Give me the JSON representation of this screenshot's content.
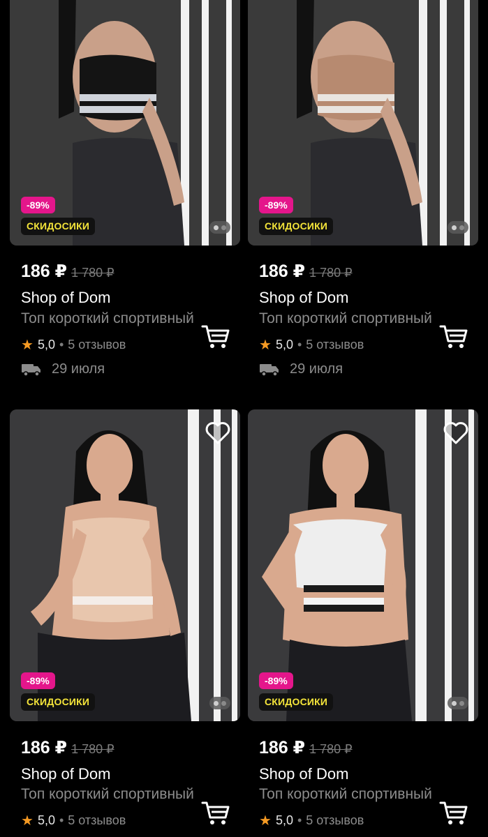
{
  "products": [
    {
      "discount": "-89%",
      "promo": "СКИДОСИКИ",
      "price": "186 ₽",
      "old_price": "1 780 ₽",
      "brand": "Shop of Dom",
      "title": "Топ короткий спортивный",
      "rating": "5,0",
      "reviews": "5 отзывов",
      "delivery": "29 июля",
      "top_color": "#141414",
      "band_color": "#cfd3da"
    },
    {
      "discount": "-89%",
      "promo": "СКИДОСИКИ",
      "price": "186 ₽",
      "old_price": "1 780 ₽",
      "brand": "Shop of Dom",
      "title": "Топ короткий спортивный",
      "rating": "5,0",
      "reviews": "5 отзывов",
      "delivery": "29 июля",
      "top_color": "#b78a70",
      "band_color": "#e9e4df"
    },
    {
      "discount": "-89%",
      "promo": "СКИДОСИКИ",
      "price": "186 ₽",
      "old_price": "1 780 ₽",
      "brand": "Shop of Dom",
      "title": "Топ короткий спортивный",
      "rating": "5,0",
      "reviews": "5 отзывов",
      "top_color": "#e8c6ad",
      "band_color": "#f4ede8"
    },
    {
      "discount": "-89%",
      "promo": "СКИДОСИКИ",
      "price": "186 ₽",
      "old_price": "1 780 ₽",
      "brand": "Shop of Dom",
      "title": "Топ короткий спортивный",
      "rating": "5,0",
      "reviews": "5 отзывов",
      "top_color": "#eeeeee",
      "band_color": "#1a1a1a"
    }
  ],
  "icons": {
    "star": "star-icon",
    "cart": "cart-icon",
    "truck": "truck-icon",
    "heart": "heart-icon",
    "dots": "carousel-dots-icon"
  },
  "colors": {
    "discount_badge": "#e4168b",
    "promo_text": "#f5e53a",
    "star": "#f59a23"
  }
}
